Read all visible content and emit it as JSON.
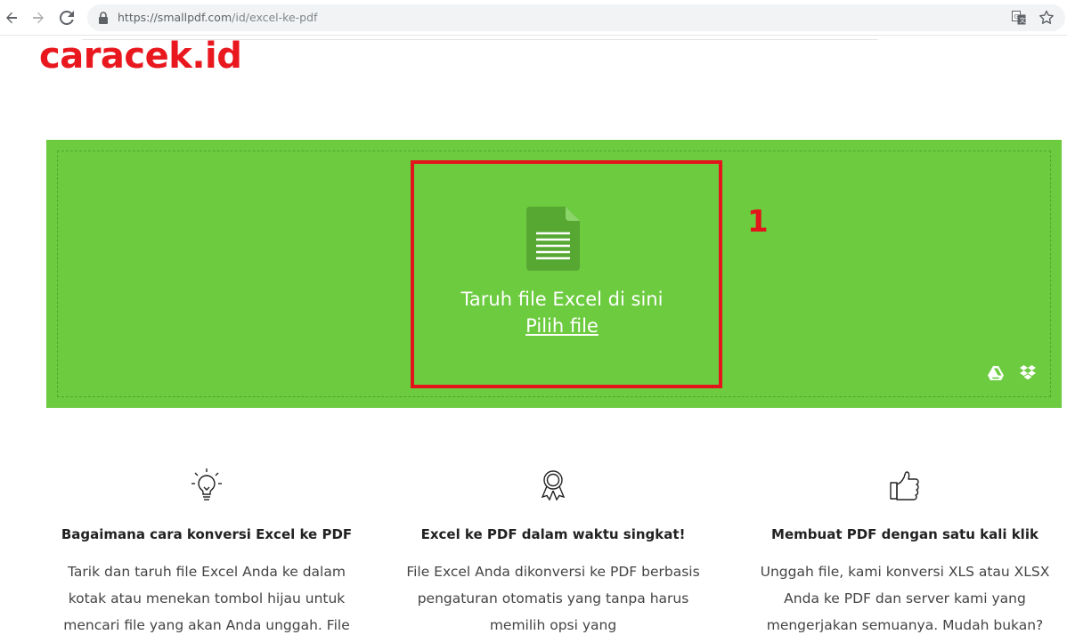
{
  "browser": {
    "url_host": "https://smallpdf.com",
    "url_path": "/id/excel-ke-pdf"
  },
  "watermark": "caracek.id",
  "dropzone": {
    "prompt": "Taruh file Excel di sini",
    "pick_label": "Pilih file",
    "annotation": "1",
    "colors": {
      "background": "#6ccb3f",
      "highlight": "#e3141b"
    }
  },
  "features": [
    {
      "icon": "lightbulb-icon",
      "title": "Bagaimana cara konversi Excel ke PDF",
      "desc": "Tarik dan taruh file Excel Anda ke dalam kotak atau menekan tombol hijau untuk mencari file yang akan Anda unggah. File"
    },
    {
      "icon": "award-icon",
      "title": "Excel ke PDF dalam waktu singkat!",
      "desc": "File Excel Anda dikonversi ke PDF berbasis pengaturan otomatis yang tanpa harus memilih opsi yang"
    },
    {
      "icon": "thumbs-up-icon",
      "title": "Membuat PDF dengan satu kali klik",
      "desc": "Unggah file, kami konversi XLS atau XLSX Anda ke PDF dan server kami yang mengerjakan semuanya. Mudah bukan?"
    }
  ]
}
